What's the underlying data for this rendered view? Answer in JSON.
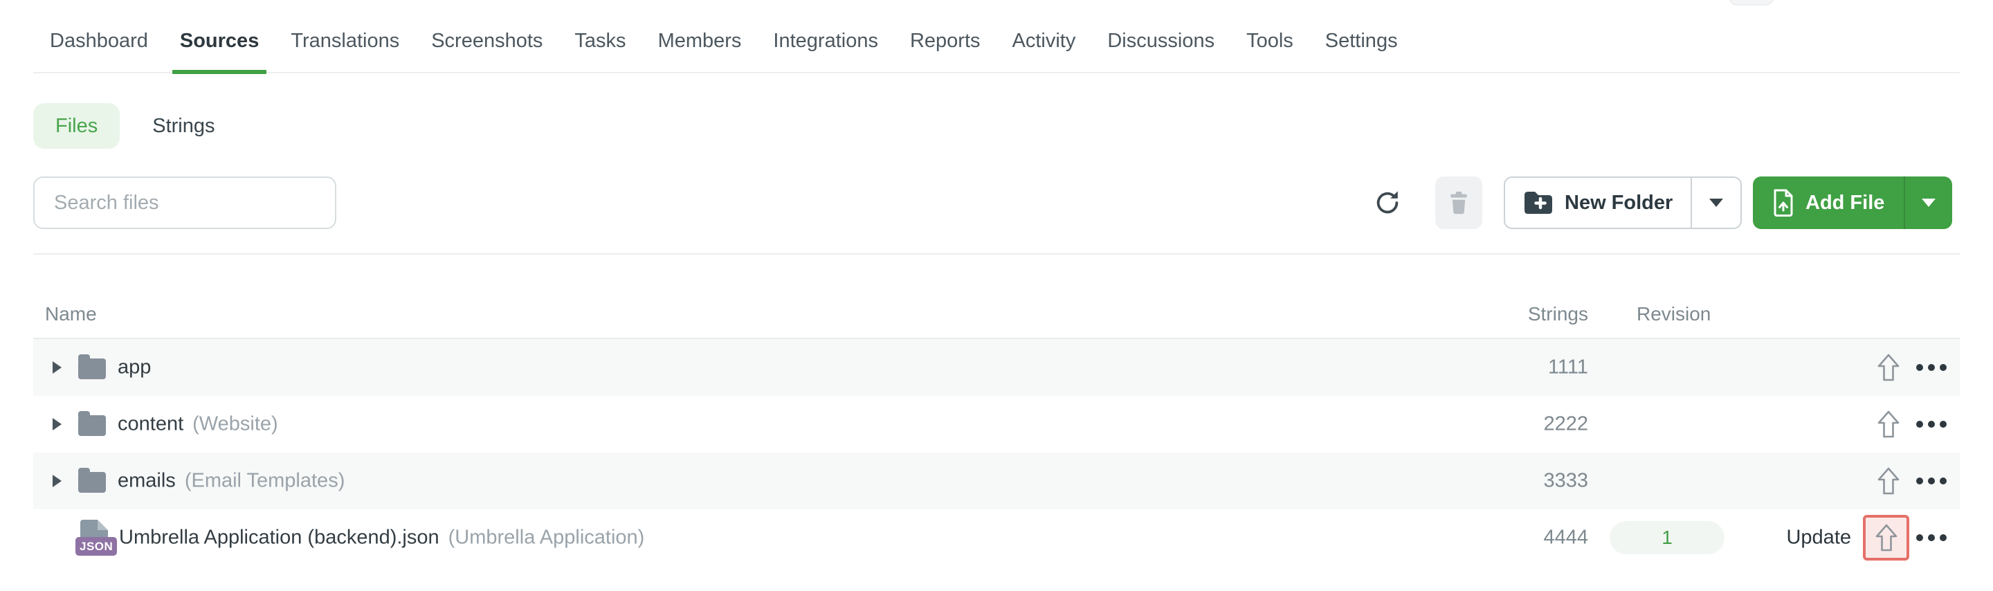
{
  "nav": {
    "items": [
      "Dashboard",
      "Sources",
      "Translations",
      "Screenshots",
      "Tasks",
      "Members",
      "Integrations",
      "Reports",
      "Activity",
      "Discussions",
      "Tools",
      "Settings"
    ],
    "active": "Sources"
  },
  "tabs": {
    "files_label": "Files",
    "strings_label": "Strings",
    "active": "Files"
  },
  "toolbar": {
    "search_placeholder": "Search files",
    "search_value": "",
    "new_folder_label": "New Folder",
    "add_file_label": "Add File"
  },
  "table": {
    "headers": {
      "name": "Name",
      "strings": "Strings",
      "revision": "Revision"
    },
    "rows": [
      {
        "type": "folder",
        "name": "app",
        "note": "",
        "strings": "1111"
      },
      {
        "type": "folder",
        "name": "content",
        "note": "(Website)",
        "strings": "2222"
      },
      {
        "type": "folder",
        "name": "emails",
        "note": "(Email Templates)",
        "strings": "3333"
      },
      {
        "type": "file",
        "name": "Umbrella Application (backend).json",
        "note": "(Umbrella Application)",
        "strings": "4444",
        "revision": "1",
        "action_label": "Update",
        "file_badge": "JSON"
      }
    ]
  },
  "icons": {
    "refresh": "circular-arrow ↻",
    "trash": "trash-can",
    "new_folder": "folder-plus",
    "add_file": "file-up-arrow",
    "dropdown_caret": "▼",
    "row_expander": "▶",
    "upload": "⇧ outline up arrow",
    "more": "••• horizontal dots"
  },
  "colors": {
    "accent_green": "#40a044",
    "files_pill_bg": "#e9f5e9",
    "files_pill_text": "#4aa54d",
    "row_stripe": "#f7f8f8",
    "revision_text": "#43a047",
    "highlight_border": "#e57069",
    "highlight_bg": "#fbe9e7"
  }
}
